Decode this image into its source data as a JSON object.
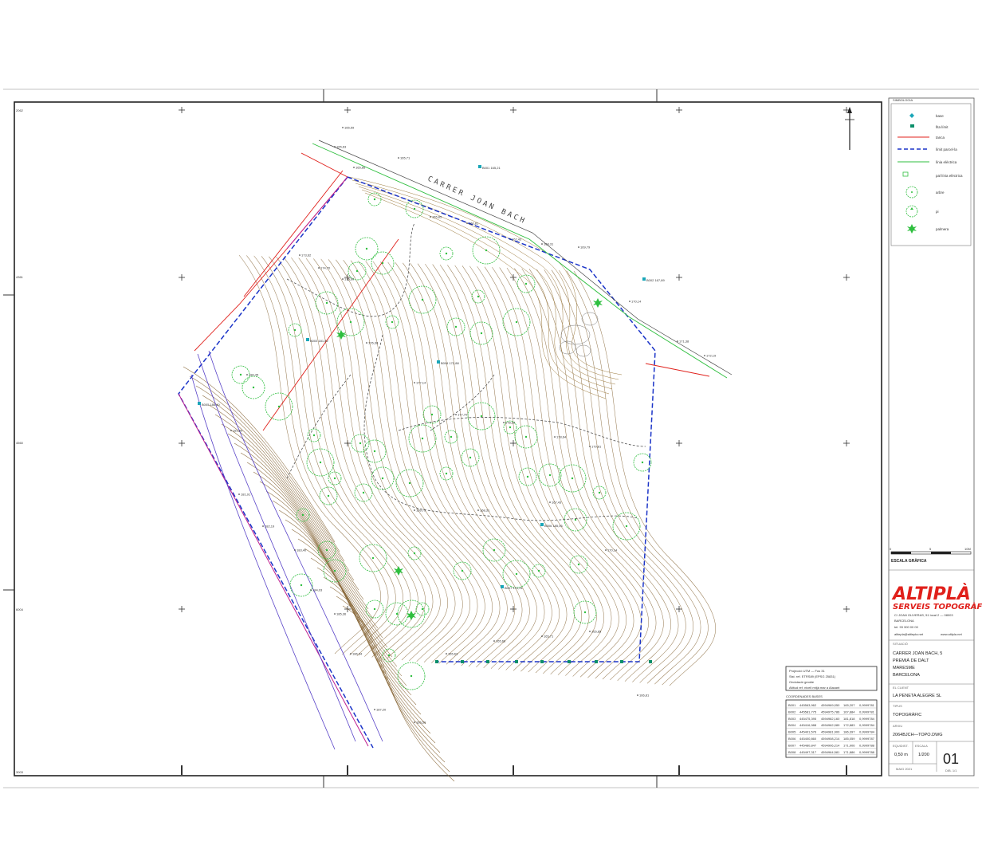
{
  "map": {
    "street_name": "CARRER JOAN BACH",
    "north_marker": "N",
    "corner_labels": [
      "2062",
      "4361",
      "4560",
      "6004",
      "3003"
    ],
    "elevation_labels": [
      "165,59",
      "165,63",
      "165,66",
      "165,71",
      "165,85",
      "166,81",
      "167,43",
      "168,31",
      "169,79",
      "170,14",
      "171,38",
      "172,19",
      "173,62",
      "174,70",
      "175,60",
      "176,38",
      "177,14",
      "177,70",
      "178,02",
      "178,64",
      "179,81",
      "180,45",
      "181,50",
      "181,91",
      "182,19",
      "183,40",
      "184,03",
      "185,36",
      "186,34",
      "187,20"
    ],
    "base_points": [
      "B001 165,21",
      "B002 167,89",
      "B003 181,82",
      "B004 172,88",
      "B005 186,40",
      "B006 185,06",
      "B007 171,91"
    ]
  },
  "legend": {
    "title": "SIMBOLOGIA",
    "items": [
      {
        "label": "base",
        "icon": "survey-base-icon",
        "color": "#1aa6b8"
      },
      {
        "label": "fita límit",
        "icon": "boundary-marker-icon",
        "color": "#0a8f6a"
      },
      {
        "label": "tanca",
        "icon": "fence-line-icon",
        "color": "#e0201b"
      },
      {
        "label": "límit parcel·la",
        "icon": "parcel-boundary-icon",
        "color": "#1b34c8"
      },
      {
        "label": "línia elèctrica",
        "icon": "power-line-icon",
        "color": "#2fbf3f"
      },
      {
        "label": "pal línia elèctrica",
        "icon": "power-pole-icon",
        "color": "#2fbf3f"
      },
      {
        "label": "arbre",
        "icon": "tree-icon",
        "color": "#2fbf3f"
      },
      {
        "label": "pi",
        "icon": "pine-icon",
        "color": "#2fbf3f"
      },
      {
        "label": "palmera",
        "icon": "palm-icon",
        "color": "#2fbf3f"
      }
    ]
  },
  "scale_bar": {
    "title": "ESCALA GRÀFICA",
    "ticks": [
      "0",
      "5",
      "10M"
    ]
  },
  "projection_box": [
    "Projecció UTM — Fus 31",
    "Sist. ref. ETRS89 (EPSG 25831)",
    "Ondulació geoide",
    "Altitud ref. nivell mitjà mar a Alacant"
  ],
  "coordinates": {
    "title": "COORDENADES BASES",
    "rows": [
      [
        "B001",
        "445563,962",
        "4594969,050",
        "165,207",
        "0,9999781"
      ],
      [
        "B002",
        "445581,775",
        "4594975,786",
        "167,884",
        "0,9999781"
      ],
      [
        "B003",
        "445475,395",
        "4594982,160",
        "181,818",
        "0,9999784"
      ],
      [
        "B004",
        "445416,988",
        "4594962,089",
        "172,883",
        "0,9999784"
      ],
      [
        "B005",
        "445401,576",
        "4594981,900",
        "186,397",
        "0,9999784"
      ],
      [
        "B006",
        "445400,860",
        "4594908,214",
        "185,059",
        "0,9999787"
      ],
      [
        "B007",
        "445480,847",
        "4594906,214",
        "171,906",
        "0,9999788"
      ],
      [
        "B008",
        "445497,317",
        "4594964,581",
        "171,886",
        "0,9999788"
      ]
    ]
  },
  "company": {
    "name": "ALTIPLÀ",
    "subtitle": "SERVEIS TOPOGRÀFICS",
    "address": "C/ JOAN OLIVERAS, 51 local 2 — 08003",
    "city": "BARCELONA",
    "phone": "tel. 93 300 00 00",
    "email": "altiepla@altiepla.net",
    "web": "www.altipla.net"
  },
  "title_block": {
    "situacio_label": "SITUACIÓ",
    "situacio_lines": [
      "CARRER JOAN BACH, 5",
      "PREMIÀ DE DALT",
      "MARESME",
      "BARCELONA"
    ],
    "client_label": "EL CLIENT",
    "client": "LA PENETA ALEGRE SL",
    "tipus_label": "TIPUS",
    "tipus": "TOPOGRÀFIC",
    "arxiu_label": "ARXIU",
    "arxiu": "2064BJCH—TOPO.DWG",
    "equidistancia_label": "EQUIDIST.",
    "equidistancia": "0,50 m",
    "escala_label": "ESCALA",
    "escala": "1/200",
    "sheet_number": "01",
    "date": "MAIG 2021",
    "drawing_ref": "DIB. 1/1"
  }
}
